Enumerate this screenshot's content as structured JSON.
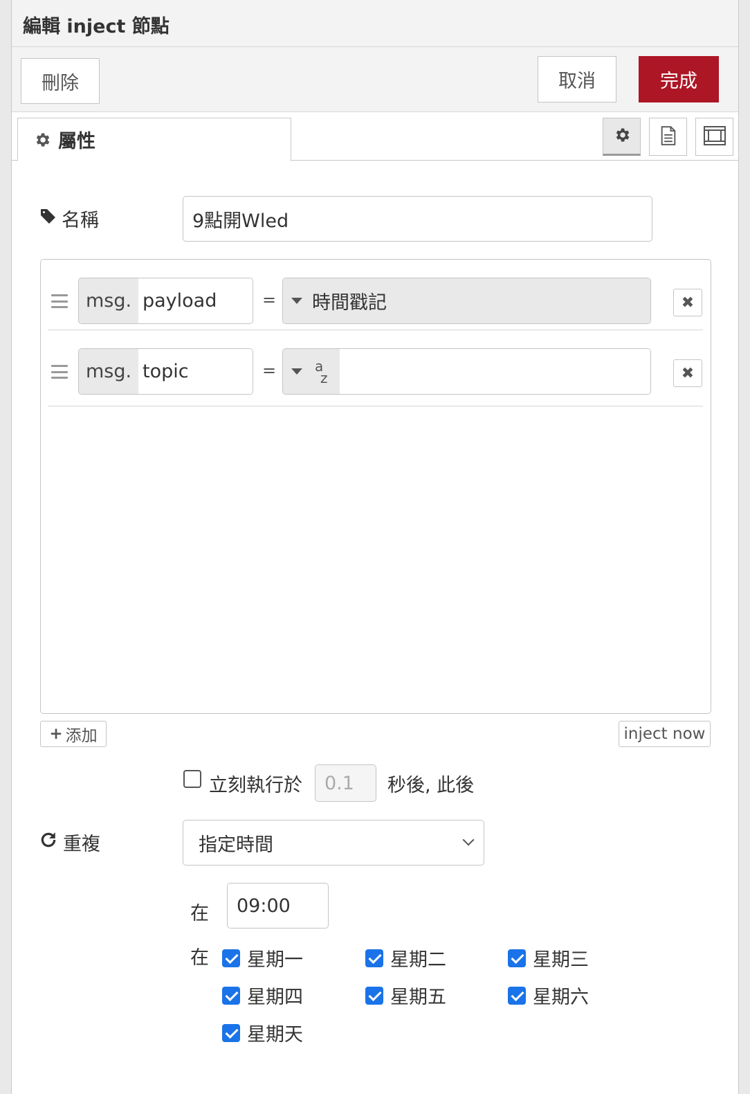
{
  "header": {
    "title": "編輯 inject 節點"
  },
  "toolbar": {
    "delete_label": "刪除",
    "cancel_label": "取消",
    "done_label": "完成"
  },
  "tabs": {
    "properties_label": "屬性"
  },
  "name_field": {
    "label": "名稱",
    "value": "9點開Wled"
  },
  "properties": [
    {
      "prefix": "msg.",
      "key": "payload",
      "equals": "=",
      "type_label": "時間戳記"
    },
    {
      "prefix": "msg.",
      "key": "topic",
      "equals": "=",
      "type_label": "",
      "type_icon": "string-az-icon"
    }
  ],
  "actions": {
    "add_label": "添加",
    "inject_now_label": "inject now"
  },
  "once": {
    "label": "立刻執行於",
    "placeholder": "0.1",
    "suffix": "秒後, 此後",
    "checked": false
  },
  "repeat": {
    "label": "重複",
    "selected": "指定時間"
  },
  "time": {
    "at_label": "在",
    "value": "09:00"
  },
  "days": {
    "at_label": "在",
    "items": [
      "星期一",
      "星期二",
      "星期三",
      "星期四",
      "星期五",
      "星期六",
      "星期天"
    ],
    "checked": [
      true,
      true,
      true,
      true,
      true,
      true,
      true
    ]
  },
  "colors": {
    "primary": "#ad1625",
    "checkbox": "#1a73e8"
  }
}
